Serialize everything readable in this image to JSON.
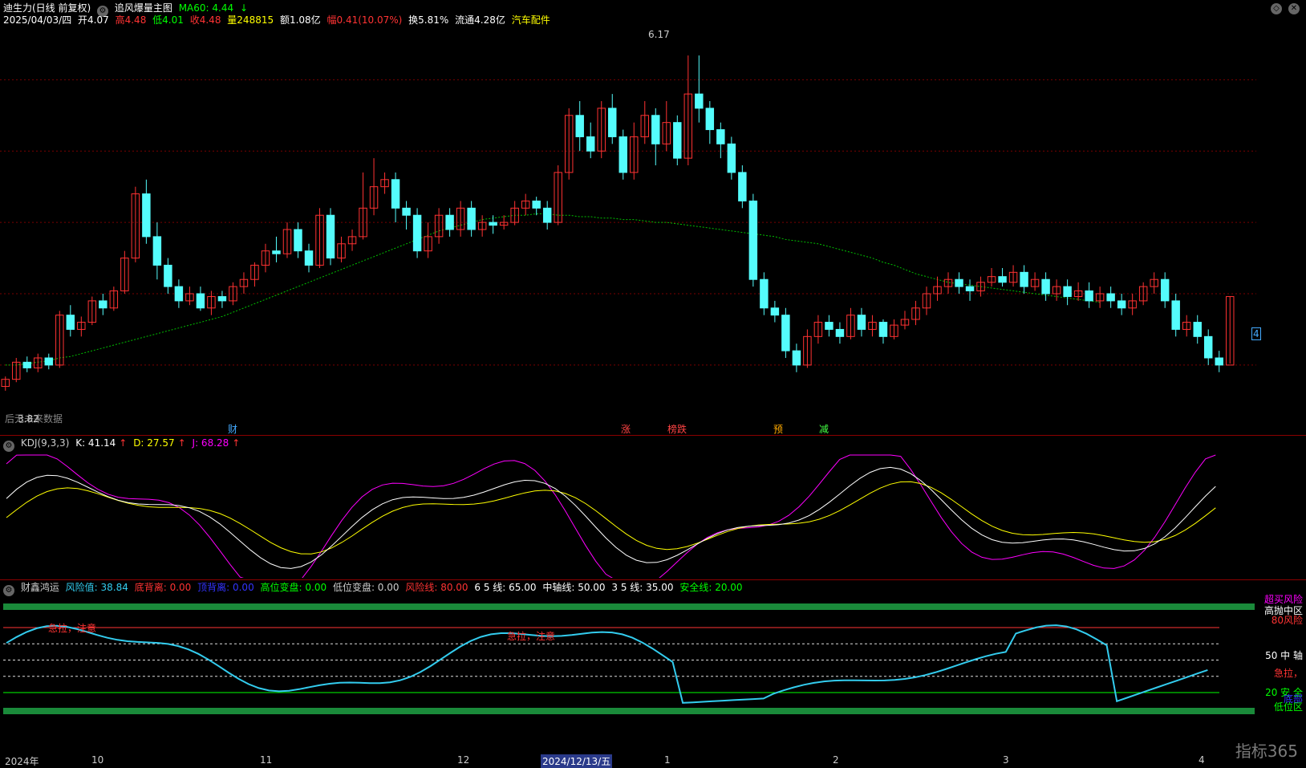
{
  "stock": {
    "name_line": "迪生力(日线 前复权)",
    "indicator_title": "追风爆量主图",
    "ma_label": "MA60: 4.44",
    "ma_arrow": "↓",
    "date": "2025/04/03/四",
    "open": "开4.07",
    "high": "高4.48",
    "low": "低4.01",
    "close": "收4.48",
    "volume": "量248815",
    "amount": "额1.08亿",
    "change": "幅0.41(10.07%)",
    "turnover": "换5.81%",
    "float": "流通4.28亿",
    "industry": "汽车配件",
    "high_price_label": "6.17",
    "low_price_label": "3.82",
    "watermark": "后无未来数据",
    "right_edge": "4"
  },
  "event_tags": [
    {
      "text": "财",
      "color": "#4af"
    },
    {
      "text": "涨",
      "color": "#f44"
    },
    {
      "text": "榜跌",
      "color": "#f44"
    },
    {
      "text": "预",
      "color": "#fa0"
    },
    {
      "text": "减",
      "color": "#4f4"
    }
  ],
  "kdj": {
    "title": "KDJ(9,3,3)",
    "k": "K: 41.14",
    "d": "D: 27.57",
    "j": "J: 68.28",
    "arrow": "↑"
  },
  "risk": {
    "title": "财鑫鸿运",
    "risk_val": "风险值: 38.84",
    "bottom_div": "底背离: 0.00",
    "top_div": "顶背离: 0.00",
    "high_change": "高位变盘: 0.00",
    "low_change": "低位变盘: 0.00",
    "risk_line": "风险线: 80.00",
    "line65": "6 5 线: 65.00",
    "mid_line": "中轴线: 50.00",
    "line35": "3 5 线: 35.00",
    "safe_line": "安全线: 20.00",
    "right_labels": [
      "超买风险",
      "高抛中区",
      "80风险",
      "50 中 轴",
      "急拉，",
      "20 安 全",
      "底部",
      "低位区"
    ],
    "annotations": [
      "急拉，注意",
      "急拉，注意"
    ]
  },
  "timeline": {
    "labels": [
      "2024年",
      "10",
      "11",
      "12",
      "2024/12/13/五",
      "1",
      "2",
      "3",
      "4"
    ]
  },
  "logo": "指标365",
  "colors": {
    "up": "#ff3232",
    "down": "#54fcfc",
    "ma": "#00c000",
    "k": "#ffffff",
    "d": "#ffff00",
    "j": "#ff00ff",
    "risk_curve": "#33ccee"
  },
  "chart_data": {
    "type": "candlestick",
    "ylim": [
      3.6,
      6.3
    ],
    "candles": [
      [
        3.85,
        3.9,
        3.82,
        3.92
      ],
      [
        3.9,
        4.02,
        3.88,
        4.05
      ],
      [
        4.02,
        3.98,
        3.95,
        4.06
      ],
      [
        3.98,
        4.05,
        3.95,
        4.08
      ],
      [
        4.05,
        4.0,
        3.97,
        4.08
      ],
      [
        4.0,
        4.35,
        3.98,
        4.38
      ],
      [
        4.35,
        4.25,
        4.2,
        4.42
      ],
      [
        4.25,
        4.3,
        4.2,
        4.34
      ],
      [
        4.3,
        4.45,
        4.28,
        4.48
      ],
      [
        4.45,
        4.4,
        4.35,
        4.5
      ],
      [
        4.4,
        4.52,
        4.38,
        4.55
      ],
      [
        4.52,
        4.75,
        4.5,
        4.8
      ],
      [
        4.75,
        5.2,
        4.72,
        5.25
      ],
      [
        5.2,
        4.9,
        4.85,
        5.3
      ],
      [
        4.9,
        4.7,
        4.6,
        5.0
      ],
      [
        4.7,
        4.55,
        4.5,
        4.75
      ],
      [
        4.55,
        4.45,
        4.4,
        4.6
      ],
      [
        4.45,
        4.5,
        4.42,
        4.55
      ],
      [
        4.5,
        4.4,
        4.38,
        4.55
      ],
      [
        4.4,
        4.48,
        4.35,
        4.52
      ],
      [
        4.48,
        4.45,
        4.4,
        4.52
      ],
      [
        4.45,
        4.55,
        4.42,
        4.58
      ],
      [
        4.55,
        4.6,
        4.5,
        4.65
      ],
      [
        4.6,
        4.7,
        4.55,
        4.72
      ],
      [
        4.7,
        4.8,
        4.65,
        4.85
      ],
      [
        4.8,
        4.78,
        4.72,
        4.9
      ],
      [
        4.78,
        4.95,
        4.75,
        5.0
      ],
      [
        4.95,
        4.8,
        4.75,
        5.0
      ],
      [
        4.8,
        4.7,
        4.65,
        4.85
      ],
      [
        4.7,
        5.05,
        4.68,
        5.1
      ],
      [
        5.05,
        4.75,
        4.7,
        5.1
      ],
      [
        4.75,
        4.85,
        4.72,
        4.9
      ],
      [
        4.85,
        4.9,
        4.8,
        4.95
      ],
      [
        4.9,
        5.1,
        4.88,
        5.35
      ],
      [
        5.1,
        5.25,
        5.05,
        5.45
      ],
      [
        5.25,
        5.3,
        5.2,
        5.35
      ],
      [
        5.3,
        5.1,
        5.0,
        5.35
      ],
      [
        5.1,
        5.05,
        4.95,
        5.15
      ],
      [
        5.05,
        4.8,
        4.75,
        5.1
      ],
      [
        4.8,
        4.9,
        4.75,
        5.0
      ],
      [
        4.9,
        5.05,
        4.85,
        5.1
      ],
      [
        5.05,
        4.95,
        4.9,
        5.1
      ],
      [
        4.95,
        5.1,
        4.9,
        5.15
      ],
      [
        5.1,
        4.95,
        4.9,
        5.15
      ],
      [
        4.95,
        5.0,
        4.9,
        5.05
      ],
      [
        5.0,
        4.98,
        4.92,
        5.05
      ],
      [
        4.98,
        5.0,
        4.95,
        5.05
      ],
      [
        5.0,
        5.1,
        4.98,
        5.15
      ],
      [
        5.1,
        5.15,
        5.05,
        5.2
      ],
      [
        5.15,
        5.1,
        5.05,
        5.18
      ],
      [
        5.1,
        5.0,
        4.95,
        5.15
      ],
      [
        5.0,
        5.35,
        4.98,
        5.4
      ],
      [
        5.35,
        5.75,
        5.3,
        5.8
      ],
      [
        5.75,
        5.6,
        5.5,
        5.85
      ],
      [
        5.6,
        5.5,
        5.45,
        5.7
      ],
      [
        5.5,
        5.8,
        5.45,
        5.85
      ],
      [
        5.8,
        5.6,
        5.55,
        5.9
      ],
      [
        5.6,
        5.35,
        5.3,
        5.65
      ],
      [
        5.35,
        5.6,
        5.3,
        5.7
      ],
      [
        5.6,
        5.75,
        5.55,
        5.85
      ],
      [
        5.75,
        5.55,
        5.4,
        5.8
      ],
      [
        5.55,
        5.7,
        5.5,
        5.85
      ],
      [
        5.7,
        5.45,
        5.4,
        5.75
      ],
      [
        5.45,
        5.9,
        5.4,
        6.17
      ],
      [
        5.9,
        5.8,
        5.7,
        6.17
      ],
      [
        5.8,
        5.65,
        5.55,
        5.85
      ],
      [
        5.65,
        5.55,
        5.45,
        5.7
      ],
      [
        5.55,
        5.35,
        5.3,
        5.6
      ],
      [
        5.35,
        5.15,
        5.1,
        5.4
      ],
      [
        5.15,
        4.6,
        4.55,
        5.2
      ],
      [
        4.6,
        4.4,
        4.35,
        4.65
      ],
      [
        4.4,
        4.35,
        4.3,
        4.45
      ],
      [
        4.35,
        4.1,
        4.05,
        4.4
      ],
      [
        4.1,
        4.0,
        3.95,
        4.15
      ],
      [
        4.0,
        4.2,
        3.98,
        4.25
      ],
      [
        4.2,
        4.3,
        4.15,
        4.35
      ],
      [
        4.3,
        4.25,
        4.2,
        4.35
      ],
      [
        4.25,
        4.2,
        4.15,
        4.3
      ],
      [
        4.2,
        4.35,
        4.18,
        4.4
      ],
      [
        4.35,
        4.25,
        4.2,
        4.4
      ],
      [
        4.25,
        4.3,
        4.2,
        4.35
      ],
      [
        4.3,
        4.2,
        4.15,
        4.32
      ],
      [
        4.2,
        4.28,
        4.18,
        4.32
      ],
      [
        4.28,
        4.32,
        4.25,
        4.38
      ],
      [
        4.32,
        4.4,
        4.28,
        4.45
      ],
      [
        4.4,
        4.5,
        4.35,
        4.55
      ],
      [
        4.5,
        4.55,
        4.45,
        4.62
      ],
      [
        4.55,
        4.6,
        4.5,
        4.65
      ],
      [
        4.6,
        4.55,
        4.5,
        4.65
      ],
      [
        4.55,
        4.52,
        4.45,
        4.6
      ],
      [
        4.52,
        4.58,
        4.48,
        4.62
      ],
      [
        4.58,
        4.62,
        4.55,
        4.68
      ],
      [
        4.62,
        4.58,
        4.55,
        4.68
      ],
      [
        4.58,
        4.65,
        4.55,
        4.7
      ],
      [
        4.65,
        4.55,
        4.5,
        4.7
      ],
      [
        4.55,
        4.6,
        4.52,
        4.65
      ],
      [
        4.6,
        4.5,
        4.45,
        4.65
      ],
      [
        4.5,
        4.55,
        4.45,
        4.6
      ],
      [
        4.55,
        4.48,
        4.42,
        4.6
      ],
      [
        4.48,
        4.52,
        4.45,
        4.58
      ],
      [
        4.52,
        4.45,
        4.4,
        4.58
      ],
      [
        4.45,
        4.5,
        4.4,
        4.55
      ],
      [
        4.5,
        4.45,
        4.4,
        4.55
      ],
      [
        4.45,
        4.4,
        4.35,
        4.5
      ],
      [
        4.4,
        4.45,
        4.35,
        4.5
      ],
      [
        4.45,
        4.55,
        4.42,
        4.58
      ],
      [
        4.55,
        4.6,
        4.5,
        4.65
      ],
      [
        4.6,
        4.45,
        4.4,
        4.65
      ],
      [
        4.45,
        4.25,
        4.2,
        4.5
      ],
      [
        4.25,
        4.3,
        4.2,
        4.35
      ],
      [
        4.3,
        4.2,
        4.15,
        4.35
      ],
      [
        4.2,
        4.05,
        4.0,
        4.25
      ],
      [
        4.05,
        4.0,
        3.95,
        4.1
      ],
      [
        4.0,
        4.48,
        4.01,
        4.48
      ]
    ],
    "ma60": [
      4.0,
      4.0,
      4.01,
      4.02,
      4.03,
      4.05,
      4.06,
      4.08,
      4.1,
      4.12,
      4.14,
      4.16,
      4.18,
      4.2,
      4.22,
      4.24,
      4.26,
      4.28,
      4.3,
      4.32,
      4.34,
      4.37,
      4.4,
      4.43,
      4.46,
      4.49,
      4.52,
      4.55,
      4.58,
      4.61,
      4.64,
      4.67,
      4.7,
      4.73,
      4.76,
      4.79,
      4.82,
      4.85,
      4.88,
      4.91,
      4.94,
      4.96,
      4.98,
      5.0,
      5.02,
      5.03,
      5.04,
      5.05,
      5.05,
      5.06,
      5.06,
      5.05,
      5.05,
      5.04,
      5.04,
      5.03,
      5.03,
      5.02,
      5.02,
      5.01,
      5.0,
      5.0,
      4.99,
      4.98,
      4.97,
      4.96,
      4.95,
      4.94,
      4.93,
      4.92,
      4.91,
      4.9,
      4.88,
      4.87,
      4.86,
      4.85,
      4.83,
      4.81,
      4.79,
      4.77,
      4.75,
      4.72,
      4.7,
      4.67,
      4.64,
      4.62,
      4.6,
      4.58,
      4.57,
      4.56,
      4.55,
      4.54,
      4.53,
      4.52,
      4.51,
      4.5,
      4.49,
      4.48,
      4.47,
      4.46,
      4.45,
      4.44
    ]
  }
}
